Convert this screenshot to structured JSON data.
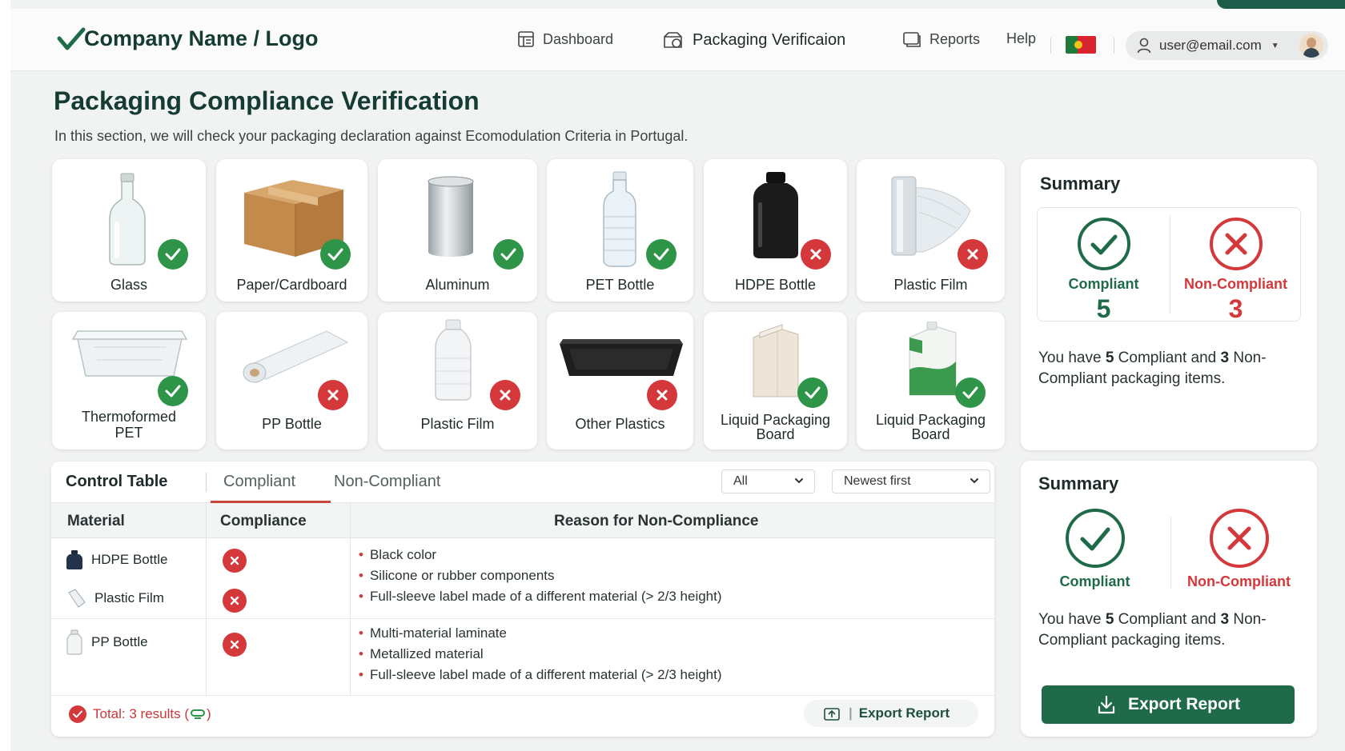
{
  "header": {
    "logo_text": "Company Name / Logo",
    "nav": {
      "dashboard": "Dashboard",
      "packaging_verification": "Packaging Verificaion",
      "reports": "Reports",
      "help": "Help"
    },
    "user_email": "user@email.com"
  },
  "page": {
    "title": "Packaging Compliance Verification",
    "subtitle": "In this section, we will check your packaging declaration against Ecomodulation Criteria in Portugal."
  },
  "materials": [
    {
      "label": "Glass",
      "status": "compliant"
    },
    {
      "label": "Paper/Cardboard",
      "status": "compliant"
    },
    {
      "label": "Aluminum",
      "status": "compliant"
    },
    {
      "label": "PET Bottle",
      "status": "compliant"
    },
    {
      "label": "HDPE Bottle",
      "status": "non-compliant"
    },
    {
      "label": "Plastic Film",
      "status": "non-compliant"
    },
    {
      "label_line1": "Thermoformed",
      "label_line2": "PET",
      "status": "compliant"
    },
    {
      "label": "PP Bottle",
      "status": "non-compliant"
    },
    {
      "label": "Plastic Film",
      "status": "non-compliant"
    },
    {
      "label": "Other Plastics",
      "status": "non-compliant"
    },
    {
      "label_line1": "Liquid Packaging",
      "label_line2": "Board",
      "status": "compliant"
    },
    {
      "label_line1": "Liquid Packaging",
      "label_line2": "Board",
      "status": "compliant"
    }
  ],
  "summary_top": {
    "title": "Summary",
    "compliant_label": "Compliant",
    "compliant_count": "5",
    "noncompliant_label": "Non-Compliant",
    "noncompliant_count": "3",
    "text_prefix": "You have ",
    "text_num1": "5",
    "text_mid": " Compliant and ",
    "text_num2": "3",
    "text_suffix": " Non-Compliant packaging items."
  },
  "summary_bottom": {
    "title": "Summary",
    "compliant_label": "Compliant",
    "noncompliant_label": "Non-Compliant",
    "text_prefix": "You have ",
    "text_num1": "5",
    "text_mid": " Compliant and ",
    "text_num2": "3",
    "text_suffix": " Non-Compliant packaging items.",
    "export_label": "Export Report"
  },
  "control_table": {
    "tabs": [
      "Control Table",
      "Compliant",
      "Non-Compliant"
    ],
    "filter_value": "All",
    "sort_value": "Newest first",
    "columns": [
      "Material",
      "Compliance",
      "Reason for Non-Compliance"
    ],
    "rows": [
      {
        "material": "HDPE Bottle"
      },
      {
        "material": "Plastic Film"
      },
      {
        "material": "PP Bottle"
      }
    ],
    "reasons": [
      "Black color",
      "Silicone or rubber components",
      "Full-sleeve label made of a different material (> 2/3 height)",
      "Multi-material laminate",
      "Metallized material",
      "Full-sleeve label made of a different material (> 2/3 height)"
    ],
    "total_text": "Total: 3 results (",
    "total_suffix": ")",
    "export_label": "Export Report"
  },
  "colors": {
    "brand_green": "#1f6b49",
    "compliant_green": "#2e9447",
    "noncompliant_red": "#d4383a"
  },
  "icons": [
    "check-icon",
    "x-icon",
    "dashboard-icon",
    "package-icon",
    "reports-icon",
    "user-icon",
    "download-icon",
    "export-icon",
    "chevron-down-icon",
    "flag-icon"
  ]
}
